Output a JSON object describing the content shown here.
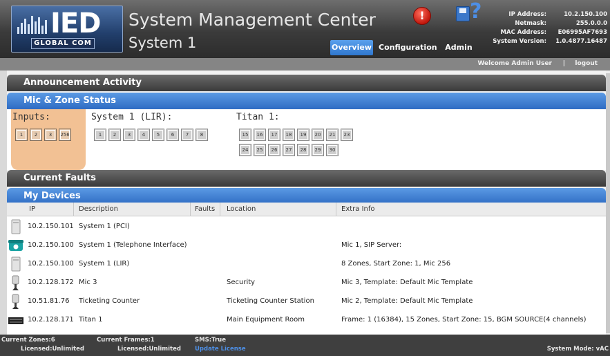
{
  "header": {
    "logo_text": "IED",
    "logo_subtext": "GLOBAL COM",
    "title": "System Management Center",
    "system_name": "System 1"
  },
  "nav": {
    "items": [
      {
        "label": "Overview",
        "active": true
      },
      {
        "label": "Configuration",
        "active": false
      },
      {
        "label": "Admin",
        "active": false
      }
    ]
  },
  "info": {
    "ip_address_label": "IP Address:",
    "ip_address": "10.2.150.100",
    "netmask_label": "Netmask:",
    "netmask": "255.0.0.0",
    "mac_address_label": "MAC Address:",
    "mac_address": "E06995AF7693",
    "system_version_label": "System Version:",
    "system_version": "1.0.4877.16487"
  },
  "welcome": {
    "text": "Welcome Admin User",
    "separator": "|",
    "logout": "logout"
  },
  "sections": {
    "announcement_activity": "Announcement Activity",
    "mic_zone_status": "Mic & Zone Status",
    "current_faults": "Current Faults",
    "my_devices": "My Devices"
  },
  "zone_status": {
    "inputs_label": "Inputs:",
    "inputs": [
      "1",
      "2",
      "3",
      "256"
    ],
    "system1_label": "System 1 (LIR):",
    "system1_zones": [
      "1",
      "2",
      "3",
      "4",
      "5",
      "6",
      "7",
      "8"
    ],
    "titan_label": "Titan 1:",
    "titan_row1": [
      "15",
      "16",
      "17",
      "18",
      "19",
      "20",
      "21",
      "23"
    ],
    "titan_row2": [
      "24",
      "25",
      "26",
      "27",
      "28",
      "29",
      "30"
    ]
  },
  "devices": {
    "columns": [
      "IP",
      "Description",
      "Faults",
      "Location",
      "Extra Info"
    ],
    "rows": [
      {
        "icon": "pc-device-icon",
        "ip": "10.2.150.101",
        "description": "System 1 (PCI)",
        "faults": "",
        "location": "",
        "extra": ""
      },
      {
        "icon": "telephone-icon",
        "ip": "10.2.150.100",
        "description": "System 1 (Telephone Interface)",
        "faults": "",
        "location": "",
        "extra": "Mic 1, SIP Server:"
      },
      {
        "icon": "pc-device-icon",
        "ip": "10.2.150.100",
        "description": "System 1 (LIR)",
        "faults": "",
        "location": "",
        "extra": "8 Zones, Start Zone: 1, Mic 256"
      },
      {
        "icon": "microphone-icon",
        "ip": "10.2.128.172",
        "description": "Mic 3",
        "faults": "",
        "location": "Security",
        "extra": "Mic 3, Template: Default Mic Template"
      },
      {
        "icon": "microphone-icon",
        "ip": "10.51.81.76",
        "description": "Ticketing Counter",
        "faults": "",
        "location": "Ticketing Counter Station",
        "extra": "Mic 2, Template: Default Mic Template"
      },
      {
        "icon": "rack-unit-icon",
        "ip": "10.2.128.171",
        "description": "Titan 1",
        "faults": "",
        "location": "Main Equipment Room",
        "extra": "Frame: 1 (16384), 15 Zones, Start Zone: 15, BGM SOURCE(4 channels)"
      }
    ]
  },
  "footer": {
    "current_zones": "Current Zones:6",
    "zones_licensed": "Licensed:Unlimited",
    "current_frames": "Current Frames:1",
    "frames_licensed": "Licensed:Unlimited",
    "sms": "SMS:True",
    "update_license": "Update License",
    "system_mode": "System Mode: vAC"
  },
  "colors": {
    "accent_blue": "#2f77cf",
    "inputs_highlight": "#f2c194",
    "header_dark": "#3b3b3b"
  }
}
